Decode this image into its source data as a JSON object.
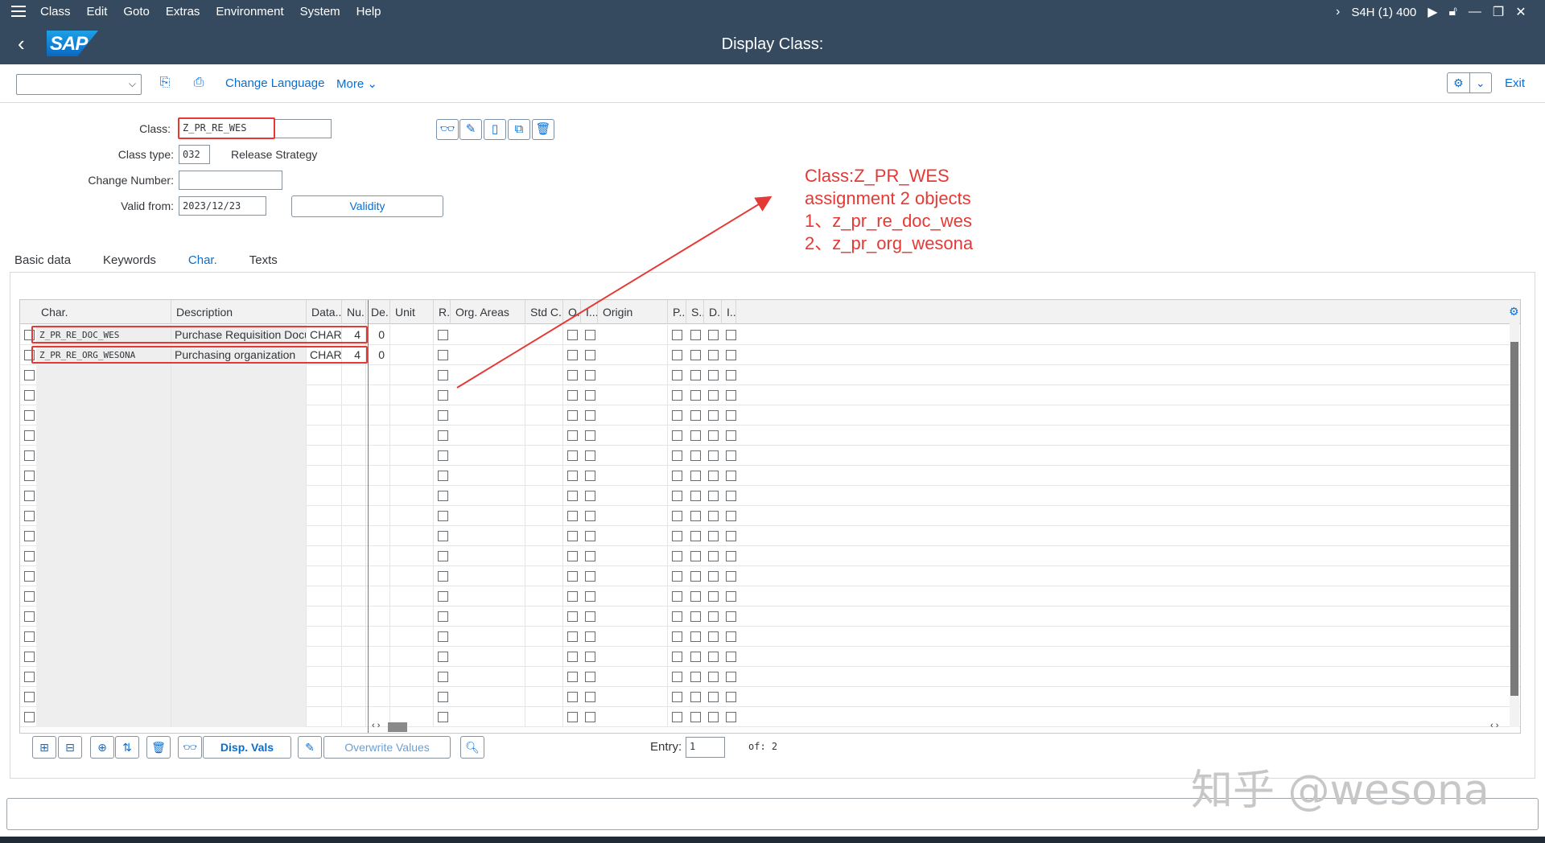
{
  "menubar": {
    "items": [
      "Class",
      "Edit",
      "Goto",
      "Extras",
      "Environment",
      "System",
      "Help"
    ],
    "system_info": "S4H (1) 400"
  },
  "titlebar": {
    "title": "Display Class:"
  },
  "toolbar": {
    "change_language": "Change Language",
    "more": "More",
    "exit": "Exit"
  },
  "header": {
    "class_label": "Class:",
    "class_value": "Z_PR_RE_WES",
    "class_type_label": "Class type:",
    "class_type_value": "032",
    "class_type_text": "Release Strategy",
    "change_number_label": "Change Number:",
    "change_number_value": "",
    "valid_from_label": "Valid from:",
    "valid_from_value": "2023/12/23",
    "validity_button": "Validity"
  },
  "annotation": {
    "lines": [
      "Class:Z_PR_WES",
      "assignment 2 objects",
      "1、z_pr_re_doc_wes",
      "2、z_pr_org_wesona"
    ]
  },
  "tabs": [
    {
      "label": "Basic data",
      "active": false
    },
    {
      "label": "Keywords",
      "active": false
    },
    {
      "label": "Char.",
      "active": true
    },
    {
      "label": "Texts",
      "active": false
    }
  ],
  "grid": {
    "columns": [
      "Char.",
      "Description",
      "Data...",
      "Nu...",
      "De...",
      "Unit",
      "R...",
      "Org. Areas",
      "Std C...",
      "O...",
      "I...",
      "Origin",
      "P...",
      "S...",
      "D...",
      "I..."
    ],
    "rows": [
      {
        "char": "Z_PR_RE_DOC_WES",
        "description": "Purchase Requisition Document",
        "data_type": "CHAR",
        "num": "4",
        "dec": "0"
      },
      {
        "char": "Z_PR_RE_ORG_WESONA",
        "description": "Purchasing organization",
        "data_type": "CHAR",
        "num": "4",
        "dec": "0"
      }
    ],
    "empty_rows": 18
  },
  "bottom": {
    "disp_vals": "Disp. Vals",
    "overwrite_values": "Overwrite Values",
    "entry_label": "Entry:",
    "entry_value": "1",
    "of_label": "of: 2"
  },
  "watermark": "知乎 @wesona",
  "colors": {
    "shell": "#354a5f",
    "accent": "#0a6ed1",
    "annotation": "#e53935"
  }
}
